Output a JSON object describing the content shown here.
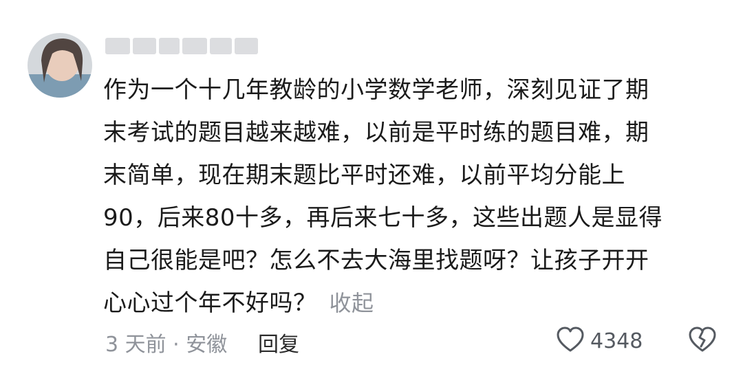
{
  "comment": {
    "avatar_icon": "user-avatar",
    "username_blurred": true,
    "content_lines": [
      "作为一个十几年教龄的小学数学老师，深刻见证了期",
      "末考试的题目越来越难，以前是平时练的题目难，期",
      "末简单，现在期末题比平时还难，以前平均分能上",
      "90，后来80十多，再后来七十多，这些出题人是显得",
      "自己很能是吧？怎么不去大海里找题呀？让孩子开开",
      "心心过个年不好吗？"
    ],
    "collapse_label": "收起",
    "time_location": "3 天前 · 安徽",
    "reply_label": "回复",
    "like_icon": "heart-outline-icon",
    "like_count": "4348",
    "dislike_icon": "broken-heart-icon"
  },
  "colors": {
    "text_primary": "#1b1b1b",
    "text_secondary": "#8f939a",
    "icon": "#555a61"
  }
}
